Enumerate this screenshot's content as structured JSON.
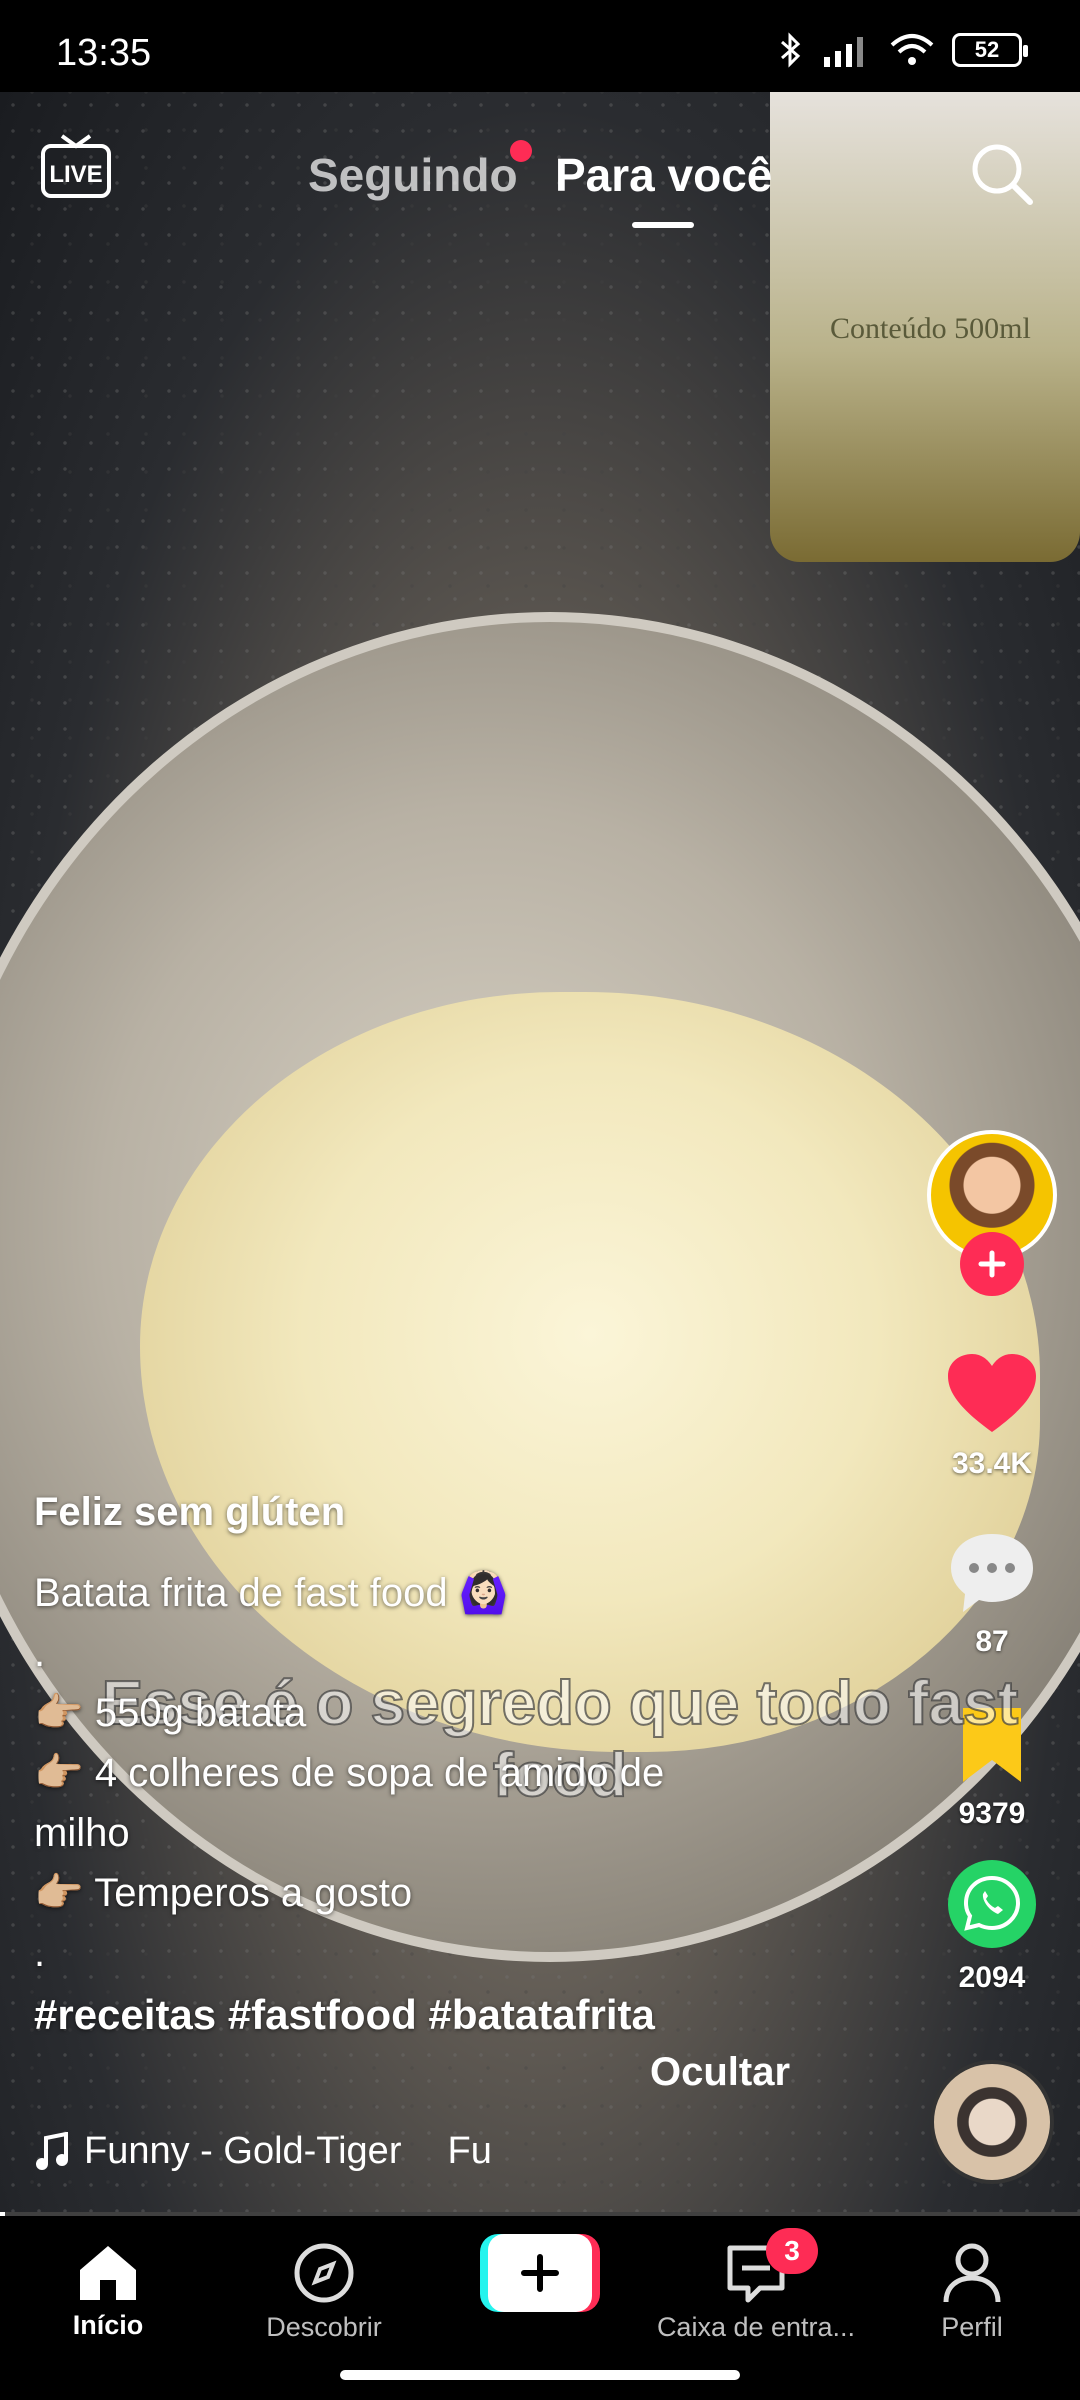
{
  "status_bar": {
    "time": "13:35",
    "battery": "52"
  },
  "top_nav": {
    "following": "Seguindo",
    "for_you": "Para você"
  },
  "video": {
    "bottle_label": "Conteúdo 500ml",
    "overlay_text": "Esse é o segredo que todo fast food"
  },
  "actions": {
    "likes": "33.4K",
    "comments": "87",
    "saves": "9379",
    "shares": "2094"
  },
  "caption": {
    "author": "Feliz sem glúten",
    "title": "Batata frita de fast food 🙆🏻‍♀️",
    "dot1": ".",
    "item1": "👉🏼 550g batata",
    "item2": "👉🏼 4 colheres de sopa de amido de",
    "item2_cont": "milho",
    "item3": "👉🏼 Temperos a gosto",
    "dot2": ".",
    "hashtags": "#receitas #fastfood #batatafrita",
    "hide": "Ocultar"
  },
  "music": {
    "track": "Funny - Gold-Tiger",
    "extra": "Fu"
  },
  "playback": {
    "progress_percent": 0.5
  },
  "bottom_nav": {
    "home": "Início",
    "discover": "Descobrir",
    "inbox": "Caixa de entra...",
    "inbox_badge": "3",
    "profile": "Perfil"
  }
}
